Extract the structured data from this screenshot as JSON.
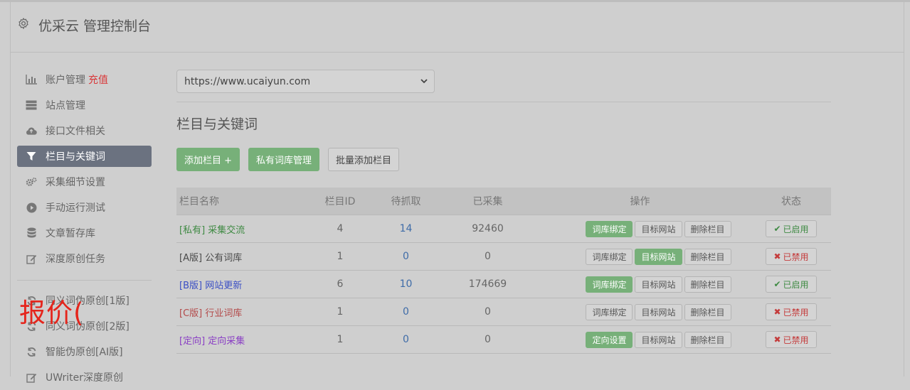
{
  "app": {
    "title": "优采云 管理控制台"
  },
  "sidebar": {
    "items": [
      {
        "label": "账户管理",
        "badge": "充值",
        "icon": "bar-chart-icon"
      },
      {
        "label": "站点管理",
        "icon": "server-icon"
      },
      {
        "label": "接口文件相关",
        "icon": "cloud-upload-icon"
      },
      {
        "label": "栏目与关键词",
        "icon": "filter-icon",
        "active": true
      },
      {
        "label": "采集细节设置",
        "icon": "gears-icon"
      },
      {
        "label": "手动运行测试",
        "icon": "play-circle-icon"
      },
      {
        "label": "文章暂存库",
        "icon": "database-icon"
      },
      {
        "label": "深度原创任务",
        "icon": "edit-icon"
      }
    ],
    "items2": [
      {
        "label": "同义词伪原创[1版]",
        "icon": "refresh-icon"
      },
      {
        "label": "同义词伪原创[2版]",
        "icon": "refresh-icon"
      },
      {
        "label": "智能伪原创[AI版]",
        "icon": "refresh-icon"
      },
      {
        "label": "UWriter深度原创",
        "icon": "edit-icon"
      }
    ],
    "watermark": "报价("
  },
  "main": {
    "site_select": "https://www.ucaiyun.com",
    "section_title": "栏目与关键词",
    "buttons": {
      "add": "添加栏目 +",
      "private": "私有词库管理",
      "batch": "批量添加栏目"
    }
  },
  "table": {
    "headers": [
      "栏目名称",
      "栏目ID",
      "待抓取",
      "已采集",
      "操作",
      "状态"
    ],
    "rows": [
      {
        "tag": "[私有]",
        "name": "采集交流",
        "id": "4",
        "pending": "14",
        "collected": "92460",
        "op1": "词库绑定",
        "op2": "目标网站",
        "op3": "删除栏目",
        "status": "已启用",
        "color": "#3f8a43",
        "op1_green": true,
        "op2_green": false,
        "status_on": true
      },
      {
        "tag": "[A版]",
        "name": "公有词库",
        "id": "1",
        "pending": "0",
        "collected": "0",
        "op1": "词库绑定",
        "op2": "目标网站",
        "op3": "删除栏目",
        "status": "已禁用",
        "color": "#4a4a4a",
        "op1_green": false,
        "op2_green": true,
        "status_on": false
      },
      {
        "tag": "[B版]",
        "name": "网站更新",
        "id": "6",
        "pending": "10",
        "collected": "174669",
        "op1": "词库绑定",
        "op2": "目标网站",
        "op3": "删除栏目",
        "status": "已启用",
        "color": "#3b4fc4",
        "op1_green": true,
        "op2_green": false,
        "status_on": true
      },
      {
        "tag": "[C版]",
        "name": "行业词库",
        "id": "1",
        "pending": "0",
        "collected": "0",
        "op1": "词库绑定",
        "op2": "目标网站",
        "op3": "删除栏目",
        "status": "已禁用",
        "color": "#b34a4a",
        "op1_green": false,
        "op2_green": false,
        "status_on": false
      },
      {
        "tag": "[定向]",
        "name": "定向采集",
        "id": "1",
        "pending": "0",
        "collected": "0",
        "op1": "定向设置",
        "op2": "目标网站",
        "op3": "删除栏目",
        "status": "已禁用",
        "color": "#8a3fc4",
        "op1_green": true,
        "op2_green": false,
        "status_on": false
      }
    ]
  }
}
